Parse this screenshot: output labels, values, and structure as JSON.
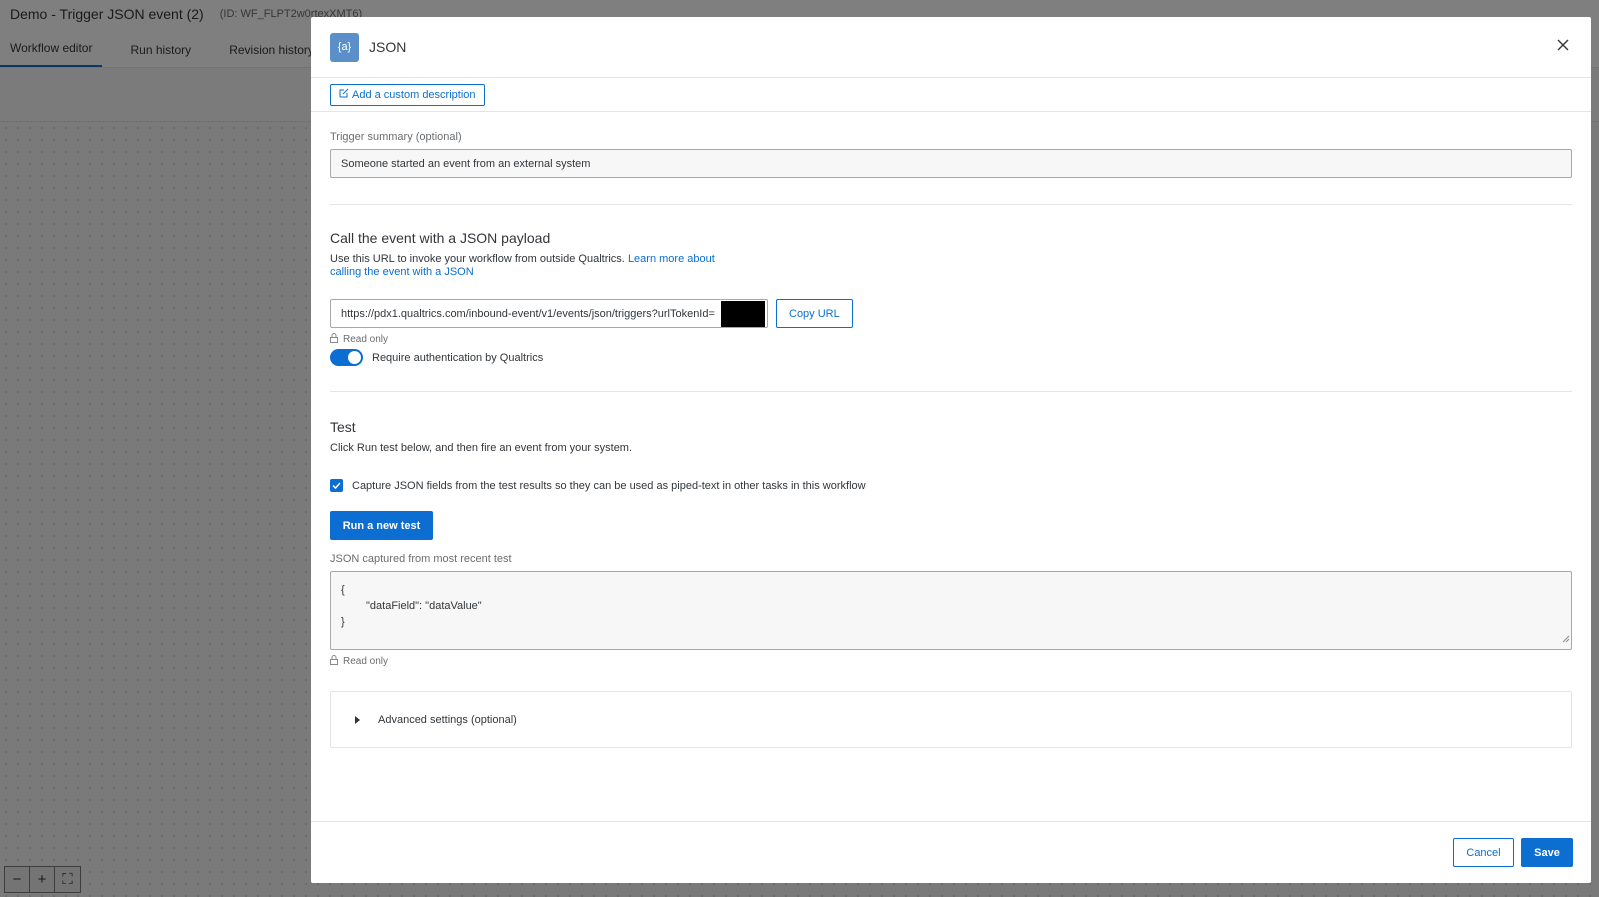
{
  "app": {
    "title": "Demo - Trigger JSON event (2)",
    "id_text": "(ID: WF_FLPT2w0rtexXMT6)",
    "tabs": [
      {
        "label": "Workflow editor",
        "active": true
      },
      {
        "label": "Run history",
        "active": false
      },
      {
        "label": "Revision history",
        "active": false
      }
    ],
    "zoom_controls": [
      "−",
      "+",
      "⛶"
    ]
  },
  "modal": {
    "badge": "{a}",
    "title": "JSON",
    "add_description": "Add a custom description",
    "trigger_summary": {
      "label": "Trigger summary (optional)",
      "value": "Someone started an event from an external system"
    },
    "call_section": {
      "title": "Call the event with a JSON payload",
      "description": "Use this URL to invoke your workflow from outside Qualtrics.",
      "learn_more": "Learn more about calling the event with a JSON",
      "url": "https://pdx1.qualtrics.com/inbound-event/v1/events/json/triggers?urlTokenId=",
      "copy_label": "Copy URL",
      "read_only": "Read only",
      "auth_label": "Require authentication by Qualtrics",
      "auth_enabled": true
    },
    "test_section": {
      "title": "Test",
      "description": "Click Run test below, and then fire an event from your system.",
      "capture_label": "Capture JSON fields from the test results so they can be used as piped-text in other tasks in this workflow",
      "capture_checked": true,
      "run_label": "Run a new test",
      "json_label": "JSON captured from most recent test",
      "json_lines": [
        "{",
        "\"dataField\": \"dataValue\"",
        "}"
      ],
      "read_only": "Read only"
    },
    "advanced_label": "Advanced settings (optional)",
    "footer": {
      "cancel": "Cancel",
      "save": "Save"
    }
  },
  "colors": {
    "accent": "#0b6ed0",
    "badge": "#5b8fc9"
  }
}
